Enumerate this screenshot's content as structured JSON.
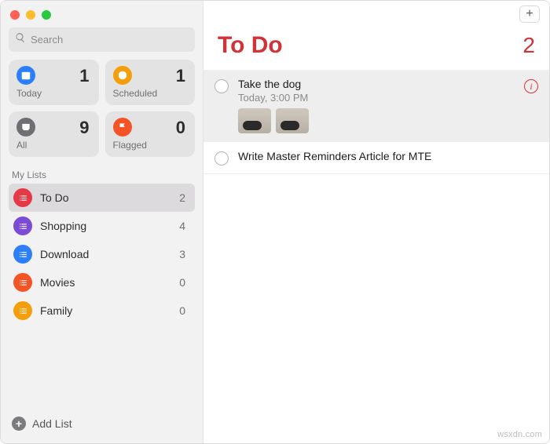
{
  "accent": "#d13438",
  "search": {
    "placeholder": "Search"
  },
  "sidebar": {
    "tiles": [
      {
        "id": "today",
        "label": "Today",
        "count": 1,
        "color": "#2d7ff9"
      },
      {
        "id": "scheduled",
        "label": "Scheduled",
        "count": 1,
        "color": "#f59e0b"
      },
      {
        "id": "all",
        "label": "All",
        "count": 9,
        "color": "#6e6e73"
      },
      {
        "id": "flagged",
        "label": "Flagged",
        "count": 0,
        "color": "#f35325"
      }
    ],
    "lists_section_label": "My Lists",
    "lists": [
      {
        "id": "todo",
        "name": "To Do",
        "count": 2,
        "color": "#e63946",
        "selected": true
      },
      {
        "id": "shopping",
        "name": "Shopping",
        "count": 4,
        "color": "#7b4bd6",
        "selected": false
      },
      {
        "id": "download",
        "name": "Download",
        "count": 3,
        "color": "#2d7ff9",
        "selected": false
      },
      {
        "id": "movies",
        "name": "Movies",
        "count": 0,
        "color": "#f35325",
        "selected": false
      },
      {
        "id": "family",
        "name": "Family",
        "count": 0,
        "color": "#f59e0b",
        "selected": false
      }
    ],
    "add_list_label": "Add List"
  },
  "main": {
    "list_title": "To Do",
    "total": 2,
    "items": [
      {
        "title": "Take the dog",
        "sub": "Today, 3:00 PM",
        "selected": true,
        "has_info": true,
        "thumbs": 2
      },
      {
        "title": "Write Master Reminders Article for MTE",
        "sub": "",
        "selected": false,
        "has_info": false,
        "thumbs": 0
      }
    ]
  },
  "watermark": "wsxdn.com"
}
